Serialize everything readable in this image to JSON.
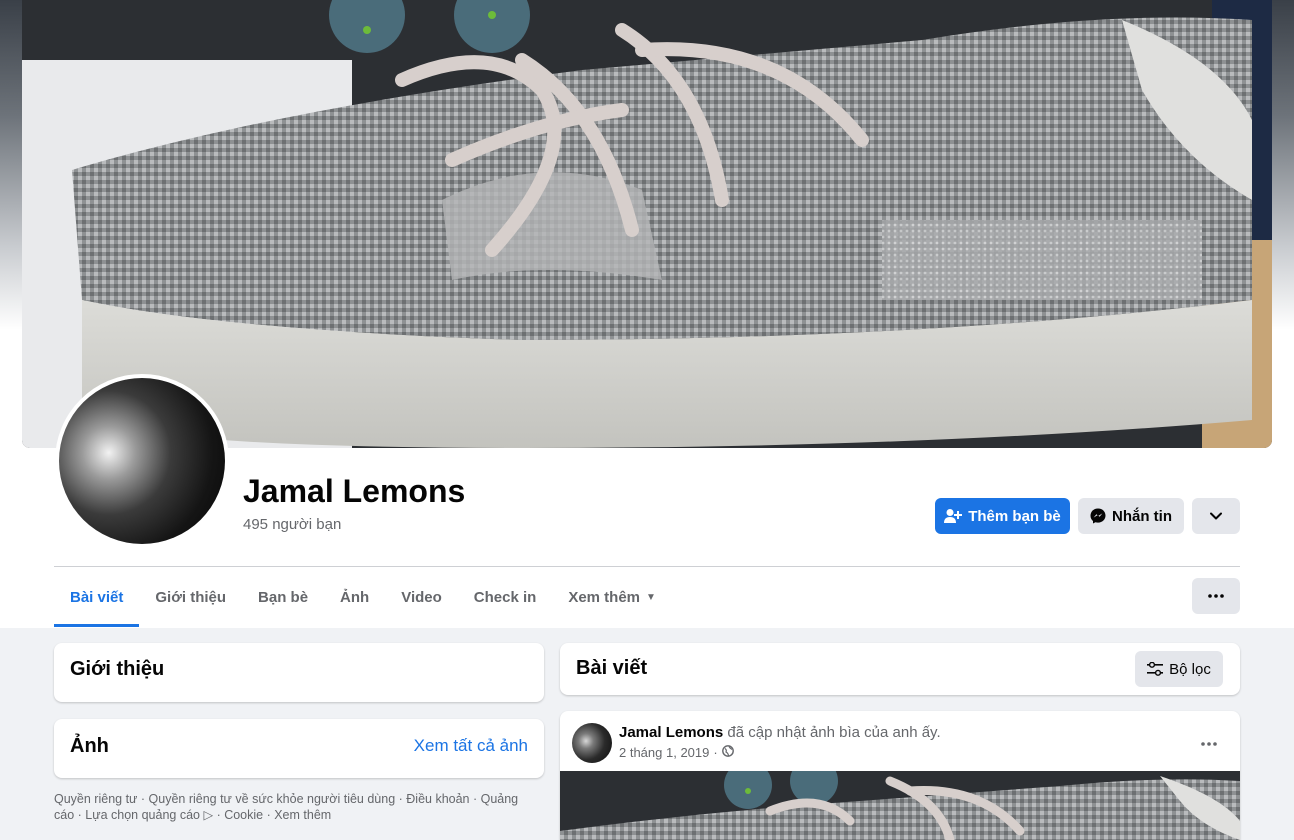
{
  "profile": {
    "name": "Jamal Lemons",
    "friends_count": "495 người bạn"
  },
  "actions": {
    "add_friend": "Thêm bạn bè",
    "message": "Nhắn tin"
  },
  "tabs": [
    {
      "label": "Bài viết",
      "active": true
    },
    {
      "label": "Giới thiệu"
    },
    {
      "label": "Bạn bè"
    },
    {
      "label": "Ảnh"
    },
    {
      "label": "Video"
    },
    {
      "label": "Check in"
    },
    {
      "label": "Xem thêm"
    }
  ],
  "intro": {
    "title": "Giới thiệu"
  },
  "photos": {
    "title": "Ảnh",
    "see_all": "Xem tất cả ảnh"
  },
  "footer": {
    "line1": "Quyền riêng tư · Quyền riêng tư về sức khỏe người tiêu dùng · Điều khoản · Quảng",
    "line2_a": "cáo · Lựa chọn quảng cáo",
    "line2_b": " · Cookie · Xem thêm"
  },
  "posts_header": {
    "title": "Bài viết",
    "filter": "Bộ lọc"
  },
  "post": {
    "author": "Jamal Lemons",
    "action": "đã cập nhật ảnh bìa của anh ấy.",
    "date": "2 tháng 1, 2019",
    "privacy_icon": "globe-icon"
  },
  "colors": {
    "accent": "#1b74e4",
    "background": "#f0f2f5",
    "secondary_text": "#65676b",
    "button_gray": "#e4e6eb"
  }
}
